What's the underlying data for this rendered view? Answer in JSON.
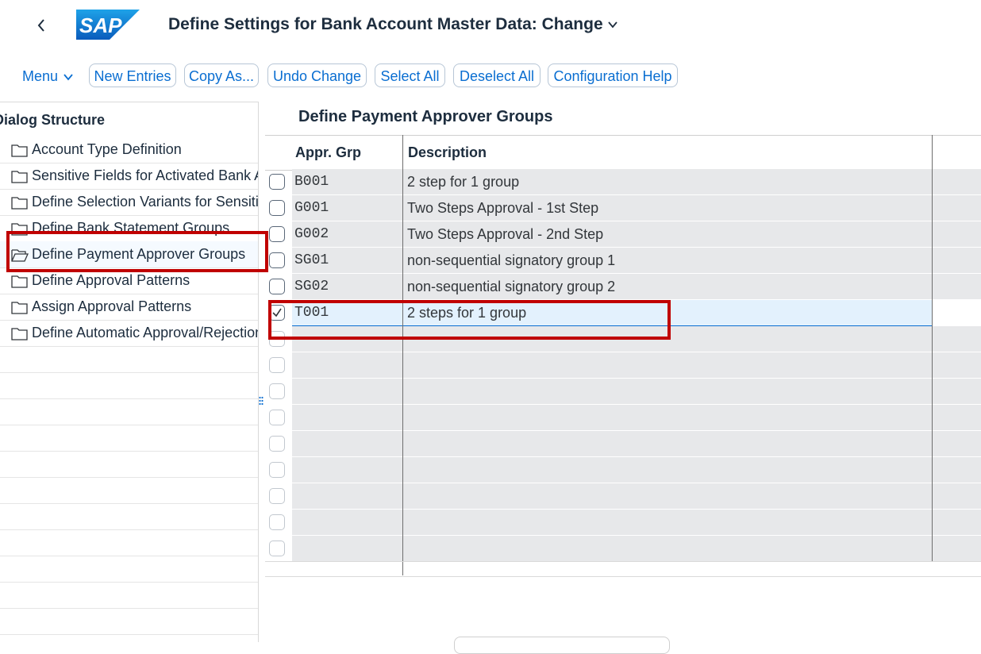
{
  "header": {
    "title": "Define Settings for Bank Account Master Data: Change",
    "logo_text": "SAP",
    "brand_color": "#0a6ed1"
  },
  "toolbar": {
    "menu_label": "Menu",
    "new_entries": "New Entries",
    "copy_as": "Copy As...",
    "undo_change": "Undo Change",
    "select_all": "Select All",
    "deselect_all": "Deselect All",
    "configuration_help": "Configuration Help"
  },
  "dialog_structure": {
    "title": "Dialog Structure",
    "items": [
      {
        "label": "Account Type Definition",
        "selected": false
      },
      {
        "label": "Sensitive Fields for Activated Bank Accounts",
        "selected": false
      },
      {
        "label": "Define Selection Variants for Sensitive Fields",
        "selected": false
      },
      {
        "label": "Define Bank Statement Groups",
        "selected": false
      },
      {
        "label": "Define Payment Approver Groups",
        "selected": true
      },
      {
        "label": "Define Approval Patterns",
        "selected": false
      },
      {
        "label": "Assign Approval Patterns",
        "selected": false
      },
      {
        "label": "Define Automatic Approval/Rejection",
        "selected": false
      }
    ]
  },
  "main": {
    "section_title": "Define Payment Approver Groups",
    "columns": [
      "Appr. Grp",
      "Description"
    ],
    "rows": [
      {
        "code": "B001",
        "description": "2 step for 1 group",
        "checked": false
      },
      {
        "code": "G001",
        "description": "Two Steps Approval - 1st Step",
        "checked": false
      },
      {
        "code": "G002",
        "description": "Two Steps Approval - 2nd Step",
        "checked": false
      },
      {
        "code": "SG01",
        "description": "non-sequential signatory group 1",
        "checked": false
      },
      {
        "code": "SG02",
        "description": "non-sequential signatory group 2",
        "checked": false
      },
      {
        "code": "T001",
        "description": "2 steps for 1 group",
        "checked": true
      }
    ]
  },
  "annotation_color": "#c00000"
}
